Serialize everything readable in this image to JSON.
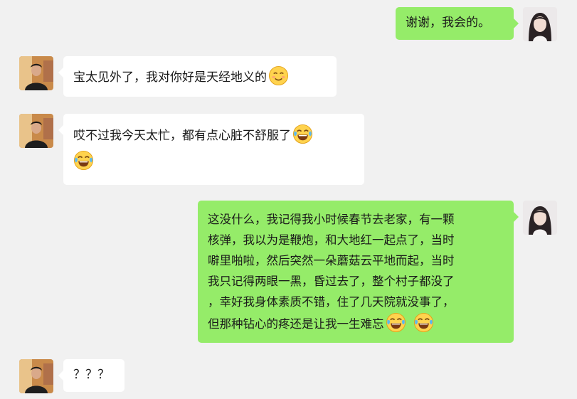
{
  "messages": [
    {
      "sender": "me",
      "text": "谢谢，我会的。"
    },
    {
      "sender": "other",
      "text": "宝太见外了，我对你好是天经地义的",
      "emoji": "smiling-face-icon"
    },
    {
      "sender": "other",
      "text": "哎不过我今天太忙，都有点心脏不舒服了",
      "emoji": "tears-of-joy-icon",
      "emoji_line2": "tears-of-joy-icon"
    },
    {
      "sender": "me",
      "lines": [
        "这没什么，我记得我小时候春节去老家，有一颗",
        "核弹，我以为是鞭炮，和大地红一起点了，当时",
        "噼里啪啦，然后突然一朵蘑菇云平地而起，当时",
        "我只记得两眼一黑，昏过去了，整个村子都没了",
        "，幸好我身体素质不错，住了几天院就没事了，",
        "但那种钻心的疼还是让我一生难忘"
      ],
      "emojis": [
        "tears-of-joy-icon",
        "tears-of-joy-icon"
      ]
    },
    {
      "sender": "other",
      "text": "？？？"
    }
  ],
  "colors": {
    "background": "#f1f1f1",
    "my_bubble": "#95ec69",
    "their_bubble": "#ffffff"
  }
}
